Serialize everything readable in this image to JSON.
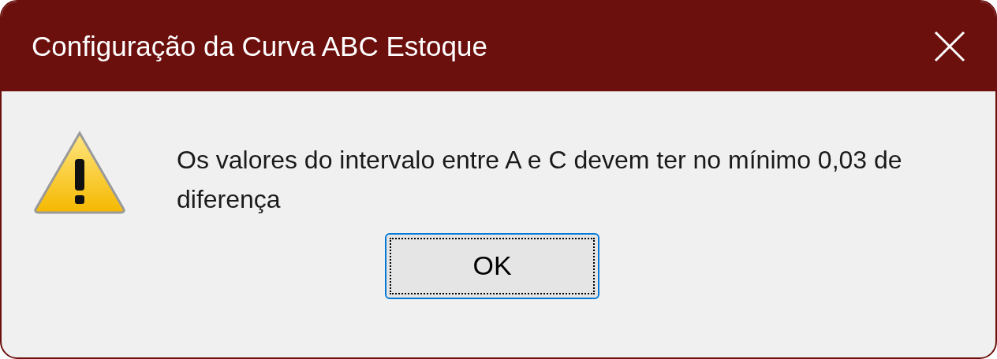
{
  "window": {
    "title": "Configuração da Curva ABC Estoque"
  },
  "message": "Os valores do intervalo entre A e C devem ter no mínimo 0,03 de diferença",
  "buttons": [
    {
      "label": "OK",
      "focused": true
    }
  ]
}
